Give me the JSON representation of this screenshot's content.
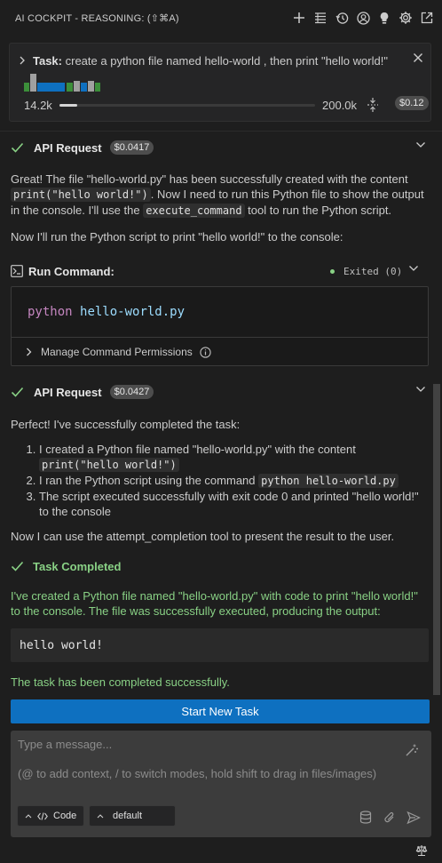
{
  "header": {
    "title": "AI COCKPIT - REASONING: (⇧⌘A)",
    "icons": [
      "plus-icon",
      "list-icon",
      "history-icon",
      "account-icon",
      "lightbulb-icon",
      "gear-icon",
      "popout-icon"
    ]
  },
  "task": {
    "label": "Task:",
    "text": "create a python file named hello-world , then print \"hello world!\"",
    "context_tokens": "14.2k",
    "context_window": "200.0k",
    "context_fill": 0.071,
    "cost": "$0.12"
  },
  "messages": [
    {
      "label": "API Request",
      "cost": "$0.0417",
      "p1_a": "Great! The file \"hello-world.py\" has been successfully created with the content ",
      "p1_code": "print(\"hello world!\")",
      "p1_b": ". Now I need to run this Python file to show the output in the console. I'll use the ",
      "p1_code2": "execute_command",
      "p1_c": " tool to run the Python script.",
      "p2": "Now I'll run the Python script to print \"hello world!\" to the console:"
    },
    {
      "label": "API Request",
      "cost": "$0.0427",
      "intro": "Perfect! I've successfully completed the task:",
      "step1_a": "I created a Python file named \"hello-world.py\" with the content ",
      "step1_code": "print(\"hello world!\")",
      "step2_a": "I ran the Python script using the command ",
      "step2_code": "python hello-world.py",
      "step3": "The script executed successfully with exit code 0 and printed \"hello world!\" to the console",
      "outro": "Now I can use the attempt_completion tool to present the result to the user."
    }
  ],
  "command": {
    "label": "Run Command:",
    "status": "Exited (0)",
    "cmd_keyword": "python",
    "cmd_arg": "hello-world.py",
    "permissions": "Manage Command Permissions"
  },
  "completion": {
    "label": "Task Completed",
    "text": "I've created a Python file named \"hello-world.py\" with code to print \"hello world!\" to the console. The file was successfully executed, producing the output:",
    "output": "hello world!",
    "final": "The task has been completed successfully."
  },
  "actions": {
    "new_task": "Start New Task"
  },
  "input": {
    "placeholder": "Type a message...",
    "hint": "(@ to add context, / to switch modes, hold shift to drag in files/images)",
    "mode": "Code",
    "profile": "default"
  },
  "colors": {
    "accent": "#0e70c0",
    "success": "#89d185"
  }
}
